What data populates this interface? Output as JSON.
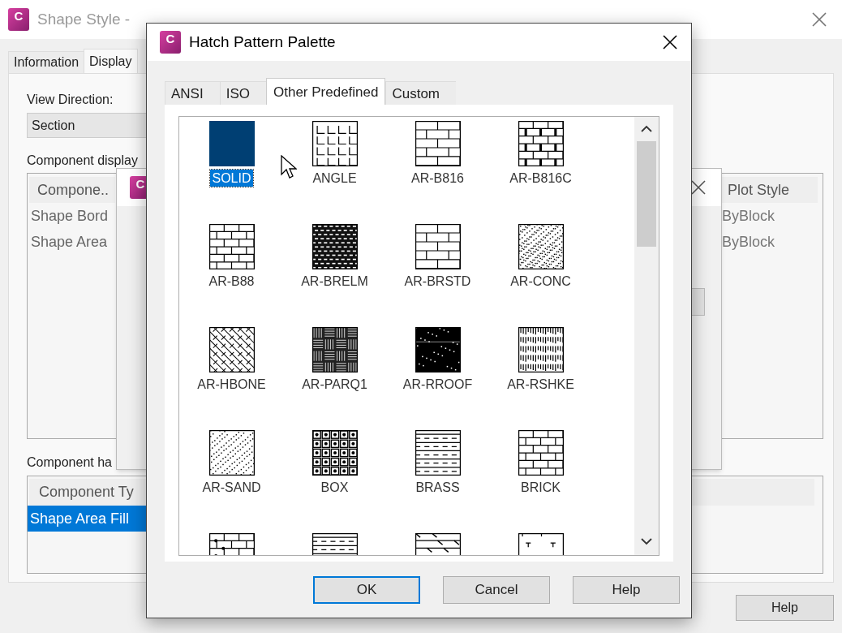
{
  "background_window": {
    "icon_letter": "C",
    "title": "Shape Style -",
    "tabs": [
      {
        "label": "Information",
        "selected": false
      },
      {
        "label": "Display",
        "selected": true
      }
    ],
    "view_direction_label": "View Direction:",
    "view_direction": "Section",
    "component_display_label": "Component display",
    "component_display_table": {
      "columns": [
        "Compone..",
        "Plot Style"
      ],
      "rows": [
        {
          "cells": [
            "Shape Bord",
            "ByBlock"
          ],
          "selected": false
        },
        {
          "cells": [
            "Shape Area",
            "ByBlock"
          ],
          "selected": false
        }
      ]
    },
    "component_hatching_label": "Component ha",
    "component_hatching_table": {
      "columns": [
        "Component Ty"
      ],
      "rows": [
        {
          "cells": [
            "Shape Area Fill"
          ],
          "selected": true
        }
      ]
    },
    "buttons": [
      "Help"
    ]
  },
  "middle_dialog": {
    "icon_letter": "C"
  },
  "hatch_dialog": {
    "icon_letter": "C",
    "title": "Hatch Pattern Palette",
    "tabs": [
      {
        "label": "ANSI",
        "selected": false
      },
      {
        "label": "ISO",
        "selected": false
      },
      {
        "label": "Other Predefined",
        "selected": true
      },
      {
        "label": "Custom",
        "selected": false
      }
    ],
    "patterns": [
      {
        "label": "SOLID",
        "kind": "solid",
        "selected": true
      },
      {
        "label": "ANGLE",
        "kind": "angle",
        "selected": false
      },
      {
        "label": "AR-B816",
        "kind": "brick",
        "selected": false
      },
      {
        "label": "AR-B816C",
        "kind": "brick-joint",
        "selected": false
      },
      {
        "label": "AR-B88",
        "kind": "brick-small",
        "selected": false
      },
      {
        "label": "AR-BRELM",
        "kind": "dense",
        "selected": false
      },
      {
        "label": "AR-BRSTD",
        "kind": "brick",
        "selected": false
      },
      {
        "label": "AR-CONC",
        "kind": "stipple",
        "selected": false
      },
      {
        "label": "AR-HBONE",
        "kind": "herringbone",
        "selected": false
      },
      {
        "label": "AR-PARQ1",
        "kind": "parquet",
        "selected": false
      },
      {
        "label": "AR-RROOF",
        "kind": "black",
        "selected": false
      },
      {
        "label": "AR-RSHKE",
        "kind": "shake",
        "selected": false
      },
      {
        "label": "AR-SAND",
        "kind": "sand",
        "selected": false
      },
      {
        "label": "BOX",
        "kind": "box",
        "selected": false
      },
      {
        "label": "BRASS",
        "kind": "dashes",
        "selected": false
      },
      {
        "label": "BRICK",
        "kind": "brick-small",
        "selected": false
      },
      {
        "kind": "brick-dots"
      },
      {
        "kind": "dashes"
      },
      {
        "kind": "slant"
      },
      {
        "kind": "tee"
      }
    ],
    "buttons": [
      {
        "label": "OK",
        "default": true
      },
      {
        "label": "Cancel",
        "default": false
      },
      {
        "label": "Help",
        "default": false
      }
    ]
  }
}
